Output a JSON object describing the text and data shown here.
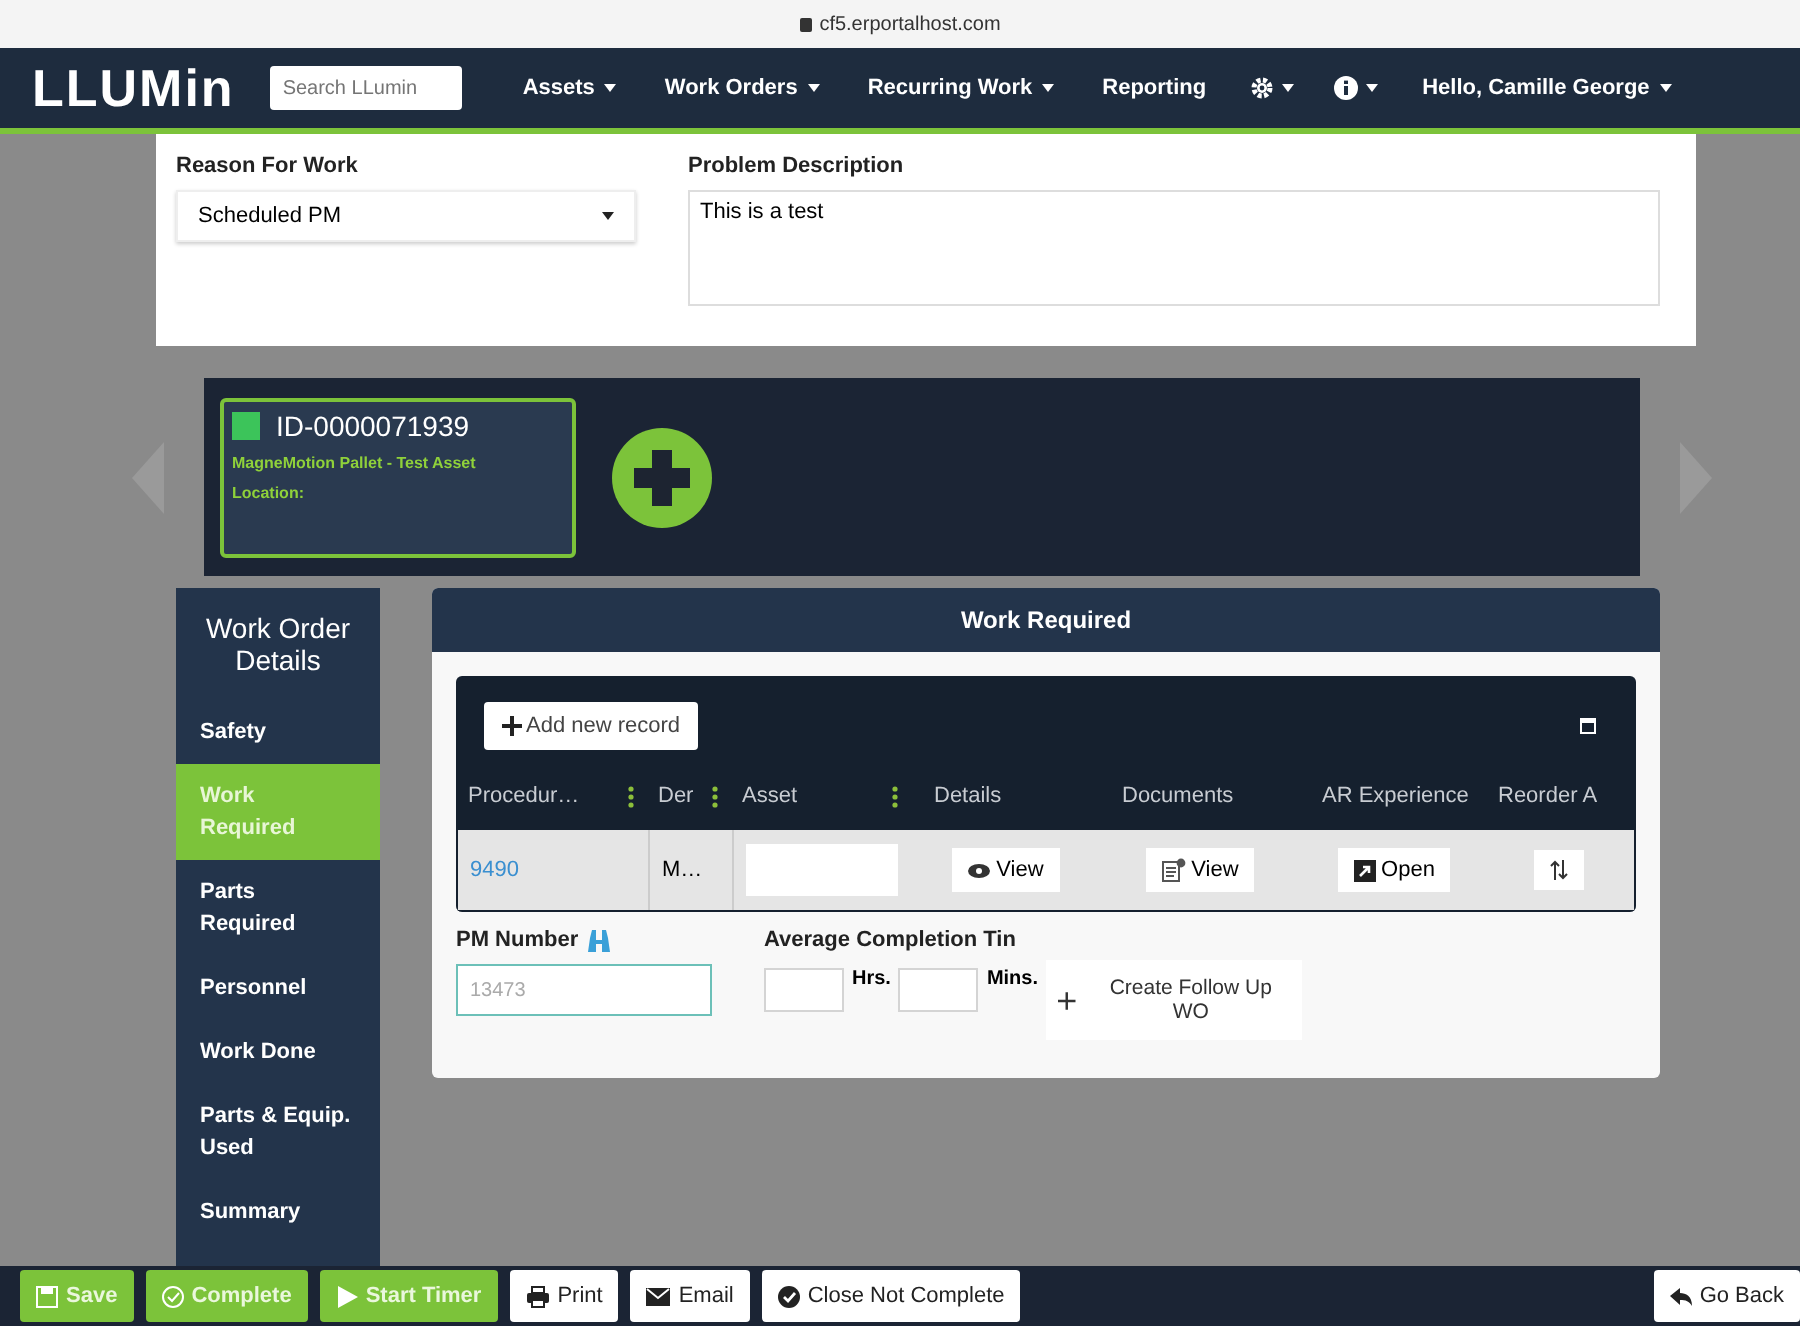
{
  "browser": {
    "url": "cf5.erportalhost.com"
  },
  "nav": {
    "logo": "LLUMin",
    "search": {
      "placeholder": "Search LLumin"
    },
    "menus": [
      {
        "label": "Assets",
        "dropdown": true
      },
      {
        "label": "Work Orders",
        "dropdown": true
      },
      {
        "label": "Recurring Work",
        "dropdown": true
      },
      {
        "label": "Reporting",
        "dropdown": false
      }
    ],
    "icon_menus": [
      {
        "kind": "gear"
      },
      {
        "kind": "info"
      }
    ],
    "user": "Hello, Camille George"
  },
  "form": {
    "reason_label": "Reason For Work",
    "reason_value": "Scheduled PM",
    "problem_label": "Problem Description",
    "problem_value": "This is a test"
  },
  "asset_card": {
    "id": "ID-0000071939",
    "name": "MagneMotion Pallet - Test Asset",
    "location": "Location:",
    "color": "#3cc45a"
  },
  "sidebar": {
    "title": "Work Order Details",
    "items": [
      {
        "label": "Safety",
        "selected": false
      },
      {
        "label": "Work Required",
        "selected": true
      },
      {
        "label": "Parts Required",
        "selected": false
      },
      {
        "label": "Personnel",
        "selected": false
      },
      {
        "label": "Work Done",
        "selected": false
      },
      {
        "label": "Parts & Equip. Used",
        "selected": false
      },
      {
        "label": "Summary",
        "selected": false
      }
    ]
  },
  "panel": {
    "title": "Work Required",
    "add_button": "Add new record",
    "columns": [
      "Procedur…",
      "Der",
      "Asset",
      "Details",
      "Documents",
      "AR Experience",
      "Reorder A"
    ],
    "row": {
      "procedure": "9490",
      "description": "M…",
      "details": "View",
      "documents": "View",
      "ar": "Open"
    },
    "pm_label": "PM Number",
    "pm_value": "13473",
    "avg_label": "Average Completion Tin",
    "hrs": "Hrs.",
    "mins": "Mins.",
    "follow_up": "Create Follow Up WO"
  },
  "footer": {
    "buttons": [
      {
        "label": "Save",
        "kind": "save"
      },
      {
        "label": "Complete",
        "kind": "complete"
      },
      {
        "label": "Start Timer",
        "kind": "timer"
      },
      {
        "label": "Print",
        "kind": "print"
      },
      {
        "label": "Email",
        "kind": "email"
      },
      {
        "label": "Close Not Complete",
        "kind": "close"
      }
    ],
    "back": "Go Back"
  }
}
